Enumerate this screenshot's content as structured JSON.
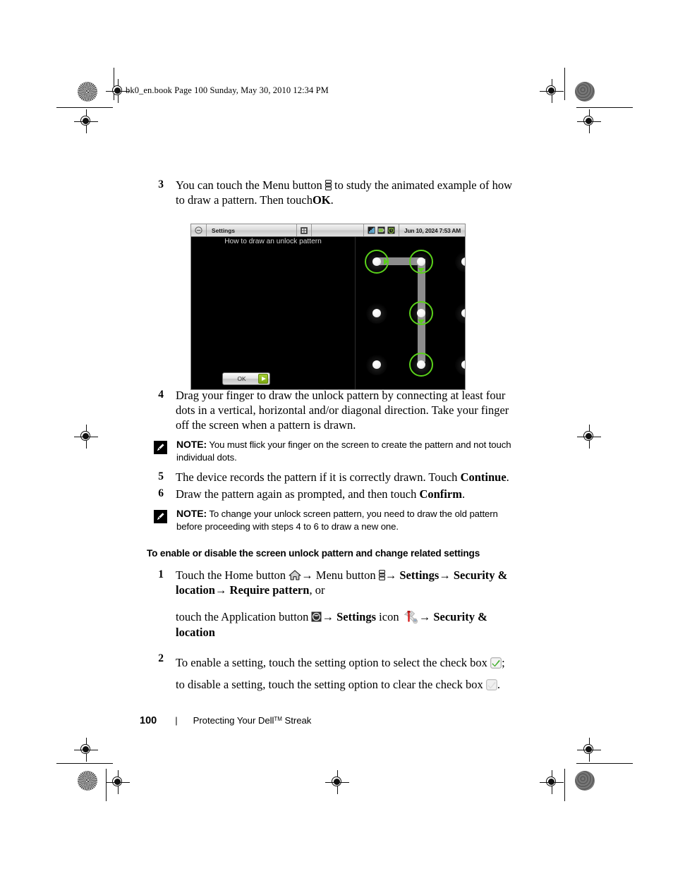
{
  "header": {
    "running_text": "bk0_en.book  Page 100  Sunday, May 30, 2010  12:34 PM"
  },
  "steps_top": [
    {
      "num": "3",
      "text_before": "You can touch the Menu button",
      "icon": "menu-button-icon",
      "text_after": "to study the animated example of how to draw a pattern. Then touch",
      "bold_end": "OK",
      "tail": "."
    }
  ],
  "device_screenshot": {
    "statusbar": {
      "back_icon": "minus-circle-icon",
      "title": "Settings",
      "app_icon": "puzzle-icon",
      "icons": [
        "signal-bars-icon",
        "battery-icon",
        "alarm-clock-icon"
      ],
      "time": "Jun 10, 2024 7:53 AM"
    },
    "caption": "How to draw an unlock pattern",
    "ok_button": {
      "label": "OK",
      "arrow_icon": "next-arrow-icon"
    },
    "pattern": {
      "rows": 3,
      "cols": 3,
      "selected_cells": [
        "r1c1",
        "r1c2",
        "r2c2",
        "r3c2"
      ],
      "path_description": "top-left to top-center, then down to center, then down to bottom-center",
      "ring_color": "#5ad11a",
      "trail_color": "#8c8c8c"
    }
  },
  "steps_mid": [
    {
      "num": "4",
      "text": "Drag your finger to draw the unlock pattern by connecting at least four dots in a vertical, horizontal and/or diagonal direction. Take your finger off the screen when a pattern is drawn."
    }
  ],
  "note_1": {
    "icon": "note-pencil-icon",
    "label": "NOTE:",
    "text": "You must flick your finger on the screen to create the pattern and not touch individual dots."
  },
  "steps_after_note": [
    {
      "num": "5",
      "text_before": "The device records the pattern if it is correctly drawn. Touch",
      "bold": "Continue",
      "tail": "."
    },
    {
      "num": "6",
      "text_before": "Draw the pattern again as prompted, and then touch",
      "bold": "Confirm",
      "tail": "."
    }
  ],
  "note_2": {
    "icon": "note-pencil-icon",
    "label": "NOTE:",
    "text": "To change your unlock screen pattern, you need to draw the old pattern before proceeding with steps 4 to 6 to draw a new one."
  },
  "section": {
    "heading": "To enable or disable the screen unlock pattern and change related settings",
    "step1": {
      "num": "1",
      "a_text": "Touch the Home button",
      "home_icon": "home-icon",
      "arrow1": "→",
      "b_text": "Menu button",
      "menu_icon": "menu-button-icon",
      "arrow2": "→",
      "c_bold": "Settings",
      "arrow3": "→",
      "d_bold": "Security & location",
      "arrow4": "→",
      "e_bold": "Require pattern",
      "tail": ", or"
    },
    "step1_alt": {
      "a_text": "touch the Application button",
      "app_icon": "application-button-icon",
      "arrow1": "→",
      "b_bold": "Settings",
      "b_text": "icon",
      "settings_icon": "settings-tools-icon",
      "arrow2": "→",
      "c_bold": "Security & location"
    },
    "step2": {
      "num": "2",
      "line1_before": "To enable a setting, touch the setting option to select the check box",
      "checked_icon": "checkbox-checked-icon",
      "line1_after": ";",
      "line2_before": "to disable a setting, touch the setting option to clear the check box",
      "unchecked_icon": "checkbox-unchecked-icon",
      "line2_after": "."
    }
  },
  "footer": {
    "page_number": "100",
    "separator": "|",
    "title": "Protecting Your Dell",
    "trademark": "TM",
    "title_end": " Streak"
  }
}
